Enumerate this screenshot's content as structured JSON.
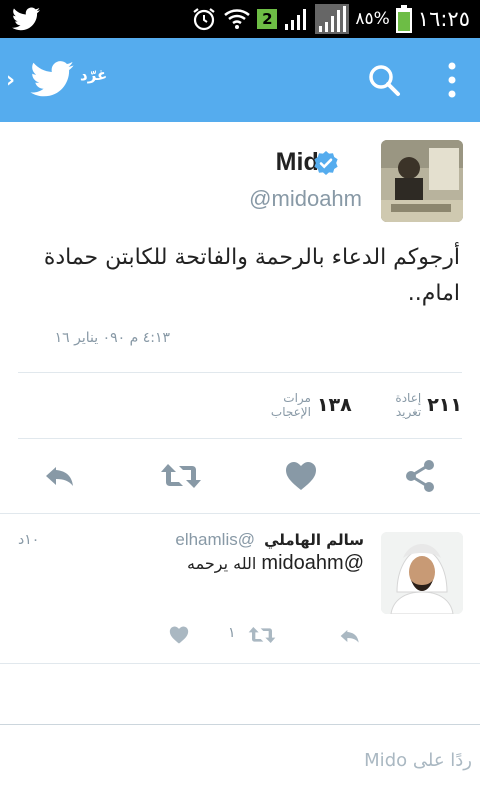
{
  "status_bar": {
    "clock": "١٦:٢٥",
    "battery": "٨٥%",
    "notification_count": "2",
    "icons": [
      "twitter-notification-icon",
      "alarm-icon",
      "wifi-icon",
      "signal-icon",
      "battery-icon"
    ]
  },
  "header": {
    "label": "غرّد",
    "icons": [
      "back-chevron-icon",
      "twitter-bird-icon",
      "search-icon",
      "overflow-menu-icon"
    ]
  },
  "tweet": {
    "author_name": "Mido",
    "author_handle": "@midoahm",
    "text": "أرجوكم الدعاء بالرحمة والفاتحة للكابتن حمادة امام..",
    "timestamp": "٤:١٣ م ٠٩٠ يناير ١٦",
    "retweets_count": "٢١١",
    "retweets_label": "إعادة تغريد",
    "likes_count": "١٣٨",
    "likes_label": "مرات الإعجاب"
  },
  "reply": {
    "author_name": "سالم الهاملي",
    "author_handle": "@elhamlis",
    "time": "١٠د",
    "mention": "@midoahm",
    "text": "الله يرحمه",
    "retweet_count": "١"
  },
  "compose": {
    "placeholder": "ردًا على Mido"
  },
  "colors": {
    "brand": "#55acee",
    "muted": "#8899a6",
    "verified": "#55acee"
  }
}
